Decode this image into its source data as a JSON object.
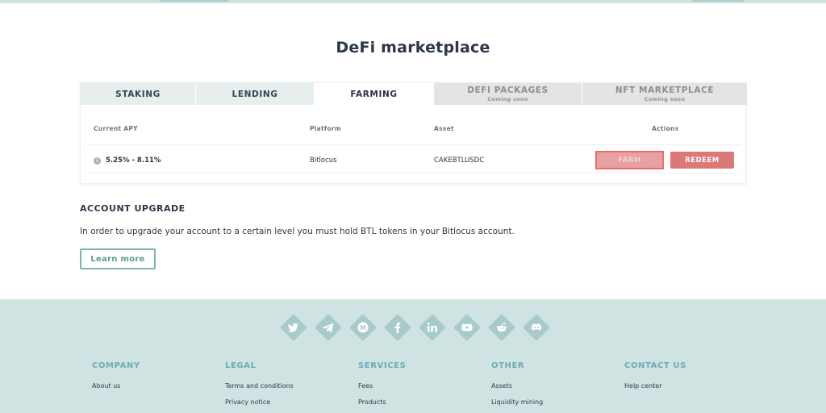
{
  "page": {
    "title": "DeFi marketplace"
  },
  "tabs": [
    {
      "label": "STAKING",
      "sub": ""
    },
    {
      "label": "LENDING",
      "sub": ""
    },
    {
      "label": "FARMING",
      "sub": ""
    },
    {
      "label": "DEFI PACKAGES",
      "sub": "Coming soon"
    },
    {
      "label": "NFT MARKETPLACE",
      "sub": "Coming soon"
    }
  ],
  "active_tab": "FARMING",
  "table": {
    "columns": [
      "Current APY",
      "Platform",
      "Asset",
      "Actions"
    ],
    "rows": [
      {
        "apy": "5.25% - 8.11%",
        "platform": "Bitlocus",
        "asset": "CAKEBTLUSDC",
        "farm": "FARM",
        "redeem": "REDEEM"
      }
    ]
  },
  "upgrade": {
    "title": "ACCOUNT UPGRADE",
    "text": "In order to upgrade your account to a certain level you must hold BTL tokens in your Bitlocus account.",
    "button": "Learn more"
  },
  "socials": [
    "twitter-icon",
    "telegram-icon",
    "medium-icon",
    "facebook-icon",
    "linkedin-icon",
    "youtube-icon",
    "reddit-icon",
    "discord-icon"
  ],
  "footer": {
    "columns": [
      {
        "title": "COMPANY",
        "links": [
          "About us"
        ]
      },
      {
        "title": "LEGAL",
        "links": [
          "Terms and conditions",
          "Privacy notice"
        ]
      },
      {
        "title": "SERVICES",
        "links": [
          "Fees",
          "Products"
        ]
      },
      {
        "title": "OTHER",
        "links": [
          "Assets",
          "Liquidity mining"
        ]
      },
      {
        "title": "CONTACT US",
        "links": [
          "Help center"
        ]
      }
    ]
  },
  "colors": {
    "accent": "#5a9e8f",
    "footer_bg": "#cfe3e3",
    "farm_button": "#e7a1a1",
    "redeem_button": "#dc7878",
    "footer_heading": "#6fa9b8"
  }
}
